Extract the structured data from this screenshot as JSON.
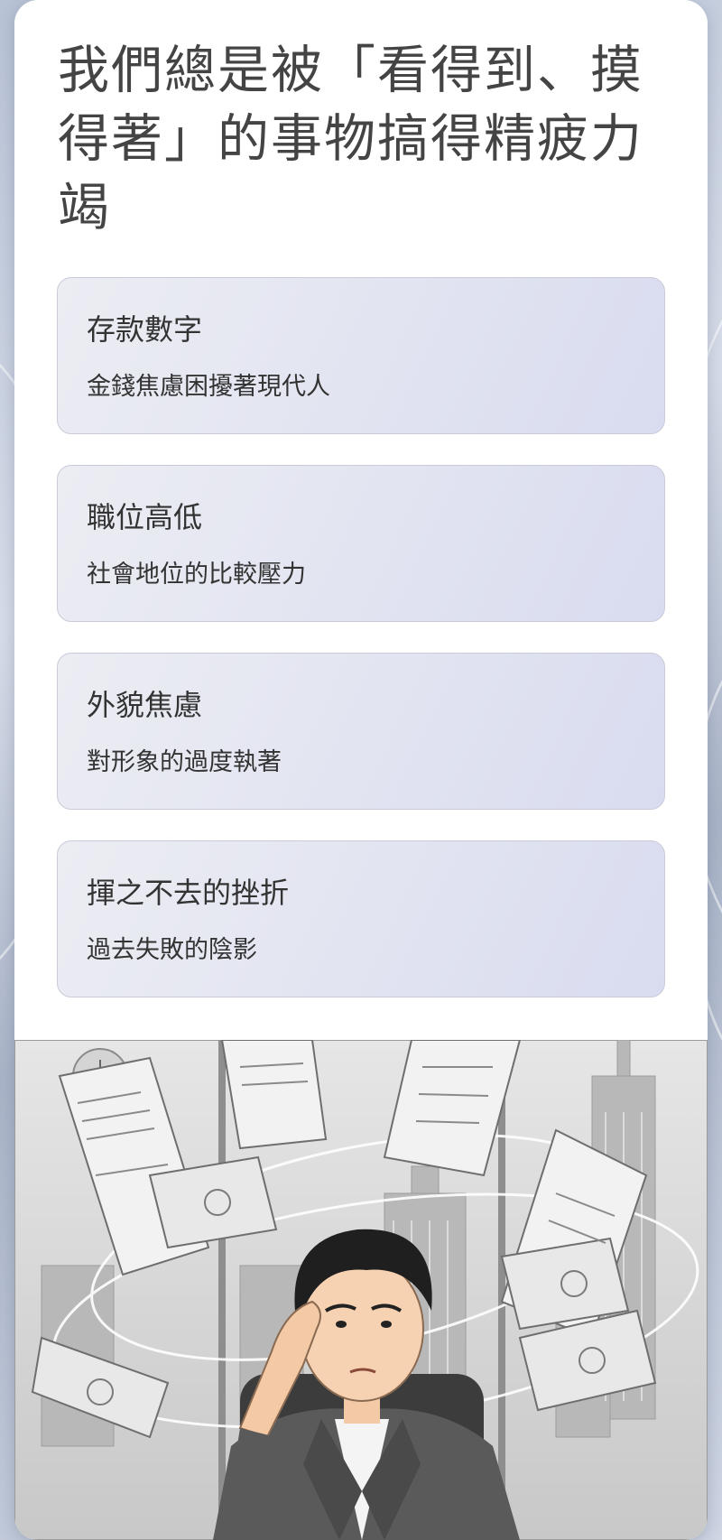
{
  "title": "我們總是被「看得到、摸得著」的事物搞得精疲力竭",
  "items": [
    {
      "heading": "存款數字",
      "description": "金錢焦慮困擾著現代人"
    },
    {
      "heading": "職位高低",
      "description": "社會地位的比較壓力"
    },
    {
      "heading": "外貌焦慮",
      "description": "對形象的過度執著"
    },
    {
      "heading": "揮之不去的挫折",
      "description": "過去失敗的陰影"
    }
  ],
  "illustration": {
    "subject": "stressed-businessman-with-flying-papers-and-money"
  },
  "colors": {
    "card": "#ffffff",
    "item_border": "#c9ccd8",
    "text": "#333333",
    "title": "#444444"
  }
}
